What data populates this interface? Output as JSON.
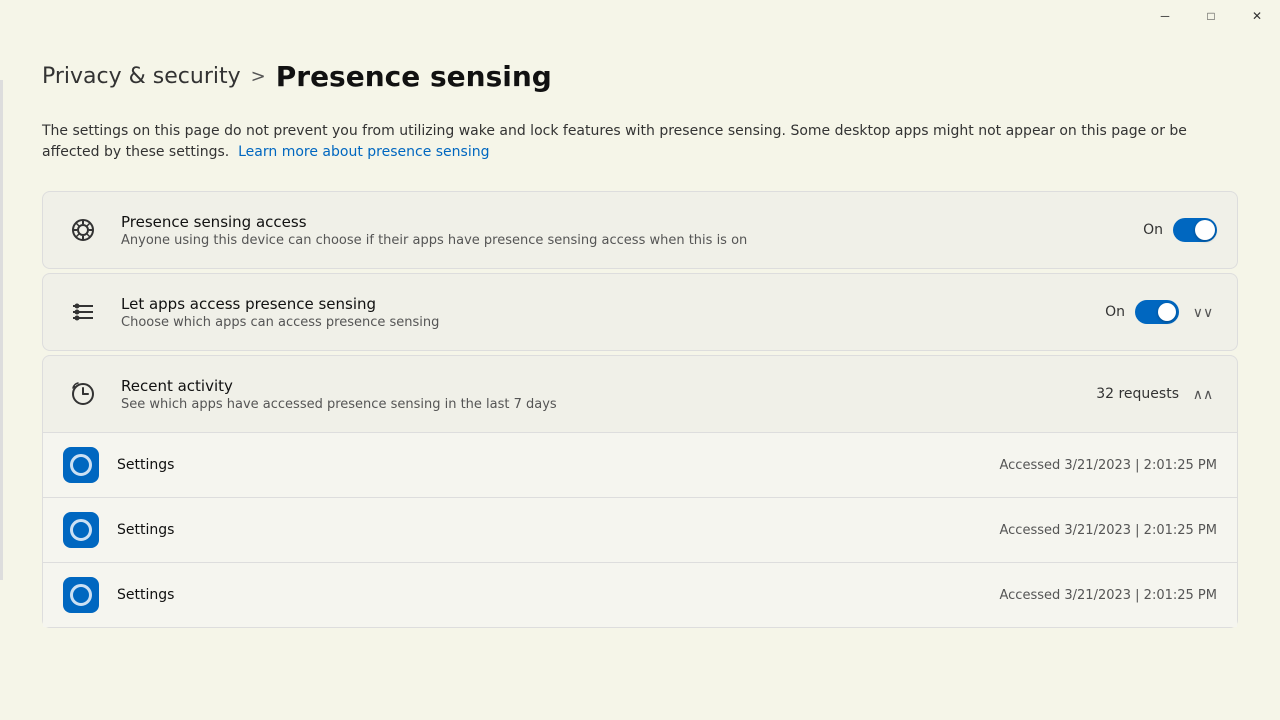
{
  "titlebar": {
    "minimize_label": "─",
    "maximize_label": "□",
    "close_label": "✕"
  },
  "breadcrumb": {
    "parent": "Privacy & security",
    "separator": ">",
    "current": "Presence sensing"
  },
  "description": {
    "text": "The settings on this page do not prevent you from utilizing wake and lock features with presence sensing. Some desktop apps might not appear on this page or be affected by these settings.",
    "link_text": "Learn more about presence sensing"
  },
  "cards": [
    {
      "id": "presence-access",
      "title": "Presence sensing access",
      "subtitle": "Anyone using this device can choose if their apps have presence sensing access when this is on",
      "toggle_state": "On",
      "toggle_on": true
    },
    {
      "id": "apps-access",
      "title": "Let apps access presence sensing",
      "subtitle": "Choose which apps can access presence sensing",
      "toggle_state": "On",
      "toggle_on": true
    }
  ],
  "activity": {
    "title": "Recent activity",
    "subtitle": "See which apps have accessed presence sensing in the last 7 days",
    "requests_count": "32 requests",
    "items": [
      {
        "app_name": "Settings",
        "access_time": "Accessed 3/21/2023  |  2:01:25 PM"
      },
      {
        "app_name": "Settings",
        "access_time": "Accessed 3/21/2023  |  2:01:25 PM"
      },
      {
        "app_name": "Settings",
        "access_time": "Accessed 3/21/2023  |  2:01:25 PM"
      }
    ]
  }
}
